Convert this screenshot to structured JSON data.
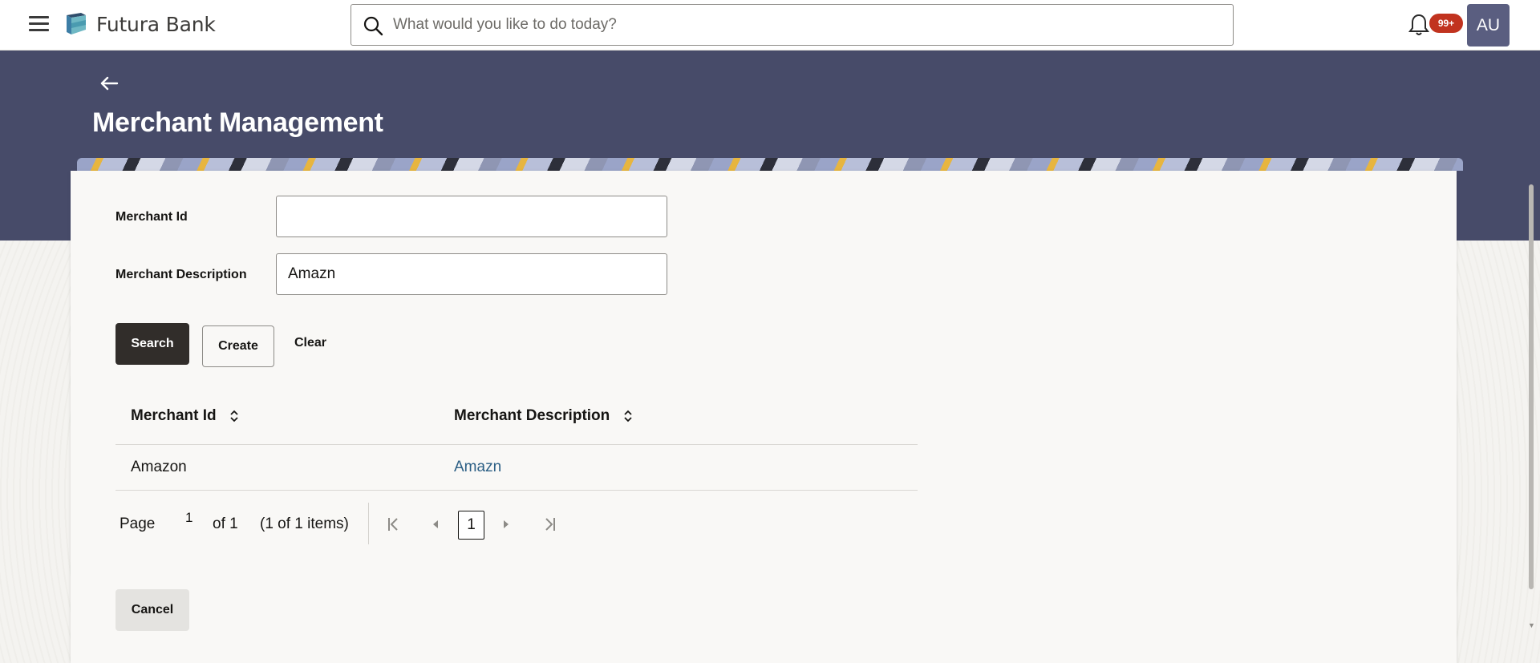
{
  "app": {
    "brand_name": "Futura Bank",
    "search_placeholder": "What would you like to do today?",
    "notification_count": "99+",
    "avatar_initials": "AU"
  },
  "page": {
    "title": "Merchant Management"
  },
  "form": {
    "merchant_id_label": "Merchant Id",
    "merchant_id_value": "",
    "merchant_description_label": "Merchant Description",
    "merchant_description_value": "Amazn"
  },
  "actions": {
    "search_label": "Search",
    "create_label": "Create",
    "clear_label": "Clear",
    "cancel_label": "Cancel"
  },
  "table": {
    "columns": [
      "Merchant Id",
      "Merchant Description"
    ],
    "rows": [
      [
        "Amazon",
        "Amazn"
      ]
    ]
  },
  "pagination": {
    "page_label": "Page",
    "current_page": "1",
    "of_label": "of 1",
    "items_label": "(1 of 1 items)",
    "page_button": "1"
  },
  "colors": {
    "header_band": "#474b69",
    "primary_button": "#312d2a",
    "badge": "#c1331f",
    "link": "#2c5f85",
    "avatar": "#5a5e80"
  },
  "icons": {
    "menu": "hamburger-icon",
    "logo": "futura-logo-icon",
    "search": "search-icon",
    "notifications": "bell-icon",
    "back": "arrow-left-icon",
    "sort": "sort-icon",
    "first_page": "first-page-icon",
    "prev_page": "prev-page-icon",
    "next_page": "next-page-icon",
    "last_page": "last-page-icon"
  }
}
